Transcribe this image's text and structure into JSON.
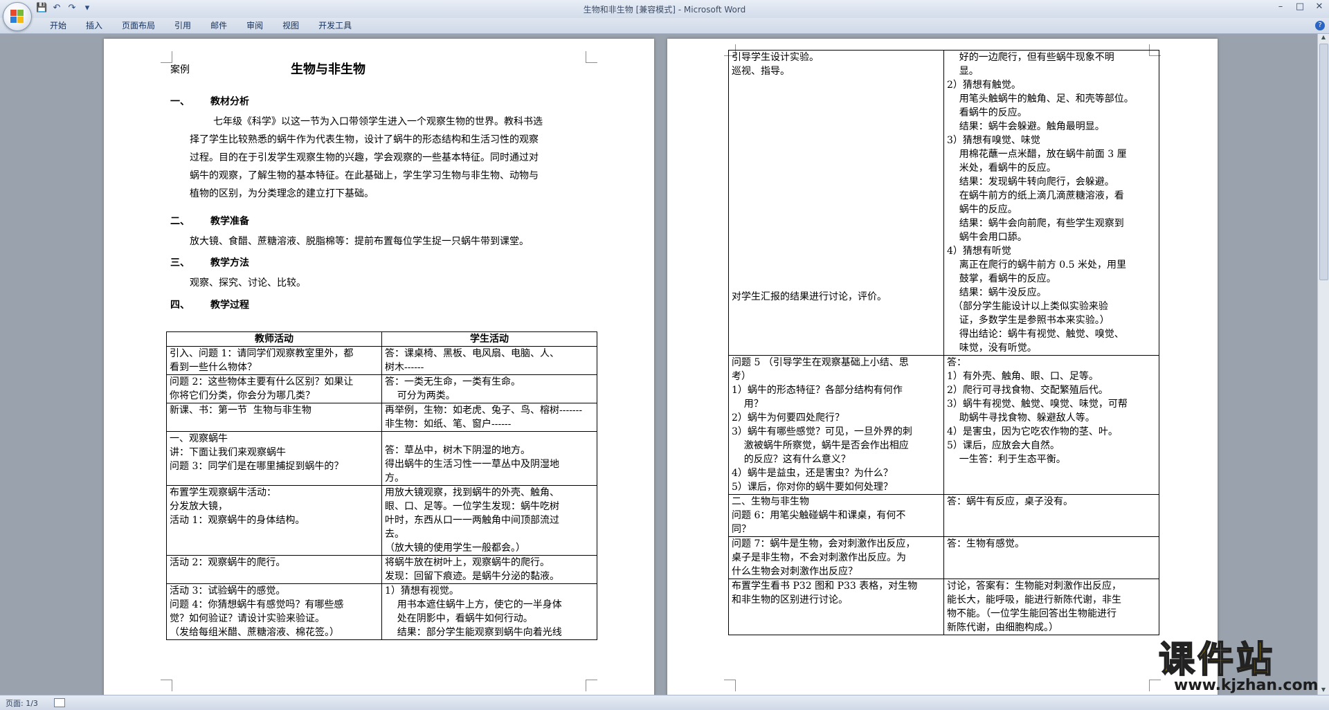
{
  "window": {
    "title": "生物和非生物 [兼容模式] - Microsoft Word",
    "qat_icons": [
      "save-icon",
      "undo-icon",
      "redo-icon",
      "customize-icon"
    ],
    "controls": [
      "–",
      "□",
      "✕"
    ]
  },
  "ribbon": {
    "tabs": [
      "开始",
      "插入",
      "页面布局",
      "引用",
      "邮件",
      "审阅",
      "视图",
      "开发工具"
    ],
    "help": "?"
  },
  "status": {
    "page": "页面: 1/3"
  },
  "page1": {
    "case_label": "案例",
    "title": "生物与非生物",
    "sections": [
      {
        "num": "一、",
        "heading": "教材分析"
      },
      {
        "num": "二、",
        "heading": "教学准备"
      },
      {
        "num": "三、",
        "heading": "教学方法"
      },
      {
        "num": "四、",
        "heading": "教学过程"
      }
    ],
    "analysis": [
      "七年级《科学》以这一节为入口带领学生进入一个观察生物的世界。教科书选",
      "择了学生比较熟悉的蜗牛作为代表生物，设计了蜗牛的形态结构和生活习性的观察",
      "过程。目的在于引发学生观察生物的兴趣，学会观察的一些基本特征。同时通过对",
      "蜗牛的观察，了解生物的基本特征。在此基础上，学生学习生物与非生物、动物与",
      "植物的区别，为分类理念的建立打下基础。"
    ],
    "preparation": "放大镜、食醋、蔗糖溶液、脱脂棉等：提前布置每位学生捉一只蜗牛带到课堂。",
    "methods": "观察、探究、讨论、比较。",
    "table_header": [
      "教师活动",
      "学生活动"
    ],
    "rows": [
      {
        "t": [
          "引入、问题 1：请同学们观察教室里外，都",
          "看到一些什么物体？"
        ],
        "s": [
          "答：课桌椅、黑板、电风扇、电脑、人、",
          "树木------"
        ]
      },
      {
        "t": [
          "问题 2：这些物体主要有什么区别？如果让",
          "你将它们分类，你会分为哪几类？"
        ],
        "s": [
          "答：一类无生命，一类有生命。",
          "    可分为两类。"
        ]
      },
      {
        "t": [
          "新课、书：第一节  生物与非生物"
        ],
        "s": [
          "再举例，生物：如老虎、兔子、鸟、榕树-------",
          "非生物：如纸、笔、窗户------"
        ]
      },
      {
        "t": [
          "一、观察蜗牛",
          "讲：下面让我们来观察蜗牛",
          "问题 3：同学们是在哪里捕捉到蜗牛的？"
        ],
        "s": [
          "",
          "答：草丛中，树木下阴湿的地方。",
          "得出蜗牛的生活习性一一草丛中及阴湿地",
          "方。"
        ]
      },
      {
        "t": [
          "布置学生观察蜗牛活动：",
          "分发放大镜，",
          "活动 1：观察蜗牛的身体结构。"
        ],
        "s": [
          "用放大镜观察，找到蜗牛的外壳、触角、",
          "眼、口、足等。一位学生发现：蜗牛吃树",
          "叶时，东西从口一一两触角中间顶部流过",
          "去。",
          "（放大镜的使用学生一般都会。）"
        ]
      },
      {
        "t": [
          "活动 2：观察蜗牛的爬行。"
        ],
        "s": [
          "将蜗牛放在树叶上，观察蜗牛的爬行。",
          "发现：回留下痕迹。是蜗牛分泌的黏液。"
        ]
      },
      {
        "t": [
          "活动 3：试验蜗牛的感觉。",
          "问题 4：你猜想蜗牛有感觉吗？有哪些感",
          "觉？如何验证？请设计实验来验证。",
          "（发给每组米醋、蔗糖溶液、棉花签。）"
        ],
        "s": [
          "1）猜想有视觉。",
          "    用书本遮住蜗牛上方，使它的一半身体",
          "    处在阴影中，看蜗牛如何行动。",
          "    结果：部分学生能观察到蜗牛向着光线"
        ]
      }
    ]
  },
  "page2": {
    "rows": [
      {
        "t": [
          "引导学生设计实验。",
          "巡视、指导。",
          "",
          "",
          "",
          "",
          "",
          "",
          "",
          "",
          "",
          "",
          "",
          "",
          "",
          "",
          "",
          "",
          "",
          "",
          "对学生汇报的结果进行讨论，评价。"
        ],
        "s": [
          "    好的一边爬行，但有些蜗牛现象不明",
          "    显。",
          "2）猜想有触觉。",
          "    用笔头触蜗牛的触角、足、和壳等部位。",
          "    看蜗牛的反应。",
          "    结果：蜗牛会躲避。触角最明显。",
          "3）猜想有嗅觉、味觉",
          "    用棉花蘸一点米醋，放在蜗牛前面 3 厘",
          "    米处，看蜗牛的反应。",
          "    结果：发现蜗牛转向爬行，会躲避。",
          "    在蜗牛前方的纸上滴几滴蔗糖溶液，看",
          "    蜗牛的反应。",
          "    结果：蜗牛会向前爬，有些学生观察到",
          "    蜗牛会用口舔。",
          "4）猜想有听觉",
          "    离正在爬行的蜗牛前方 0.5 米处，用里",
          "    鼓掌，看蜗牛的反应。",
          "    结果：蜗牛没反应。",
          "  （部分学生能设计以上类似实验来验",
          "    证，多数学生是参照书本来实验。）",
          "    得出结论：蜗牛有视觉、触觉、嗅觉、",
          "    味觉，没有听觉。"
        ]
      },
      {
        "t": [
          "问题 5 （引导学生在观察基础上小结、思",
          "考）",
          "1）蜗牛的形态特征？各部分结构有何作",
          "    用？",
          "2）蜗牛为何要四处爬行？",
          "3）蜗牛有哪些感觉？可见，一旦外界的刺",
          "    激被蜗牛所察觉，蜗牛是否会作出相应",
          "    的反应？这有什么意义？",
          "4）蜗牛是益虫，还是害虫？为什么？",
          "5）课后，你对你的蜗牛要如何处理？"
        ],
        "s": [
          "答：",
          "1）有外壳、触角、眼、口、足等。",
          "2）爬行可寻找食物、交配繁殖后代。",
          "3）蜗牛有视觉、触觉、嗅觉、味觉，可帮",
          "    助蜗牛寻找食物、躲避敌人等。",
          "4）是害虫，因为它吃农作物的茎、叶。",
          "5）课后，应放会大自然。",
          "    一生答：利于生态平衡。"
        ]
      },
      {
        "t": [
          "二、生物与非生物",
          "问题 6：用笔尖触碰蜗牛和课桌，有何不",
          "同？"
        ],
        "s": [
          "答：蜗牛有反应，桌子没有。"
        ]
      },
      {
        "t": [
          "问题 7：蜗牛是生物，会对刺激作出反应，",
          "桌子是非生物，不会对刺激作出反应。为",
          "什么生物会对刺激作出反应？"
        ],
        "s": [
          "答：生物有感觉。"
        ]
      },
      {
        "t": [
          "布置学生看书 P32 图和 P33 表格，对生物",
          "和非生物的区别进行讨论。"
        ],
        "s": [
          "讨论，答案有：生物能对刺激作出反应，",
          "能长大，能呼吸，能进行新陈代谢，非生",
          "物不能。（一位学生能回答出生物能进行",
          "新陈代谢，由细胞构成。）"
        ]
      }
    ]
  },
  "watermark": {
    "title": "课件站",
    "url": "www.kjzhan.com"
  }
}
